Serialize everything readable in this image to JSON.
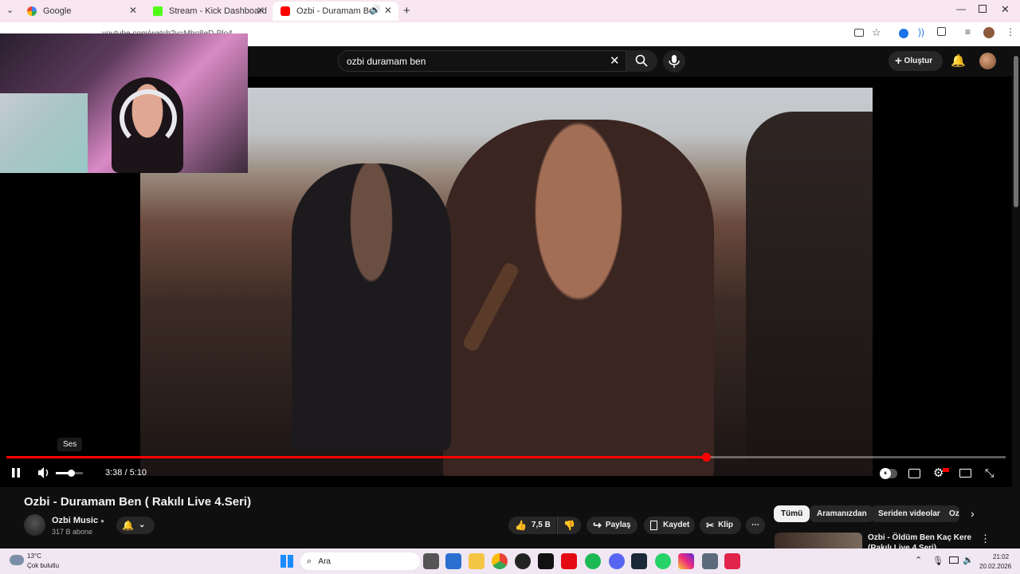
{
  "browser": {
    "tabs": [
      {
        "title": "Google",
        "active": false
      },
      {
        "title": "Stream - Kick Dashboard",
        "active": false
      },
      {
        "title": "Ozbi - Duramam Ben ( Rak",
        "active": true
      }
    ],
    "address": "youtube.com/watch?v=Mbo8eD-Plo4"
  },
  "youtube": {
    "search_value": "ozbi duramam ben",
    "create_label": "Oluştur",
    "player": {
      "current_time": "3:38",
      "duration": "5:10",
      "time_display": "3:38 / 5:10",
      "progress": 0.7,
      "volume": 0.55,
      "tooltip": "Ses"
    },
    "video": {
      "title": "Ozbi - Duramam Ben ( Rakılı Live 4.Seri)",
      "channel": "Ozbi Music",
      "subscribers": "317 B abone",
      "likes": "7,5 B",
      "share_label": "Paylaş",
      "save_label": "Kaydet",
      "clip_label": "Klip"
    },
    "chips": [
      "Tümü",
      "Aramanızdan",
      "Seriden videolar",
      "Oz"
    ],
    "recommendation": {
      "title_line1": "Ozbi - Öldüm Ben Kaç Kere",
      "title_line2": "(Rakılı Live 4.Seri)"
    }
  },
  "taskbar": {
    "weather_temp": "13°C",
    "weather_desc": "Çok bulutlu",
    "search_label": "Ara",
    "time": "21:02",
    "date": "20.02.2026"
  },
  "colors": {
    "accent": "#ff0000",
    "bg": "#0f0f0f"
  }
}
